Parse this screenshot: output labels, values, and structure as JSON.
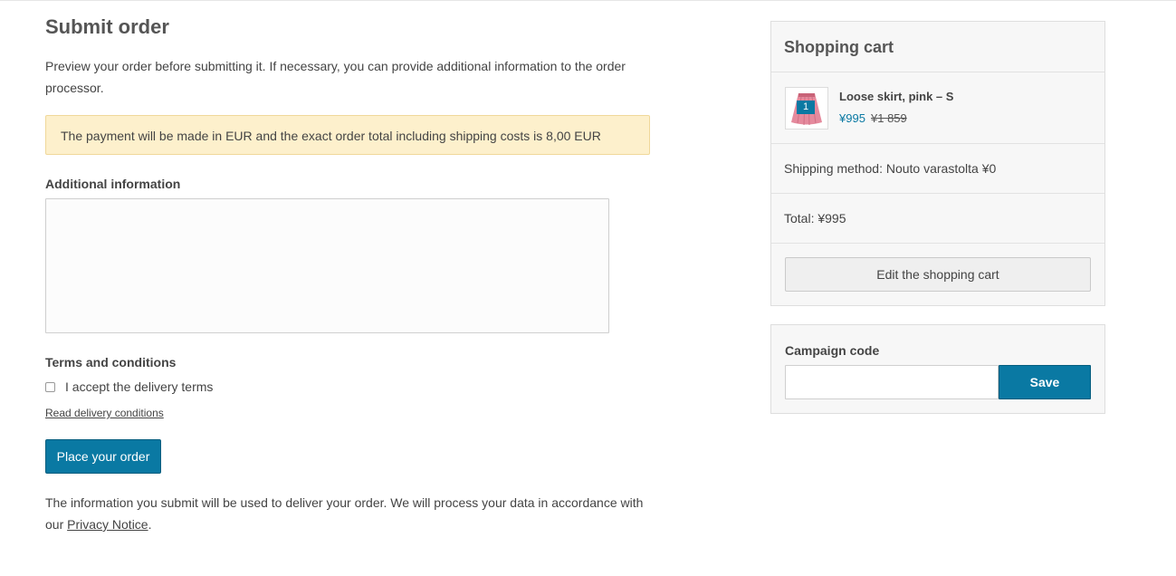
{
  "page": {
    "title": "Submit order",
    "intro": "Preview your order before submitting it. If necessary, you can provide additional information to the order processor.",
    "notice": "The payment will be made in EUR and the exact order total including shipping costs is 8,00 EUR"
  },
  "additional_info": {
    "label": "Additional information",
    "value": ""
  },
  "terms": {
    "heading": "Terms and conditions",
    "checkbox_label": "I accept the delivery terms",
    "checked": false,
    "read_link": "Read delivery conditions"
  },
  "actions": {
    "place_order_label": "Place your order"
  },
  "footnote": {
    "text_before": "The information you submit will be used to deliver your order. We will process your data in accordance with our ",
    "link": "Privacy Notice",
    "text_after": "."
  },
  "cart": {
    "title": "Shopping cart",
    "item": {
      "name": "Loose skirt, pink – S",
      "quantity": "1",
      "price": "¥995",
      "original_price": "¥1 859",
      "thumbnail_icon": "pink-skirt-image"
    },
    "shipping": "Shipping method: Nouto varastolta ¥0",
    "total": "Total: ¥995",
    "edit_label": "Edit the shopping cart"
  },
  "campaign": {
    "label": "Campaign code",
    "value": "",
    "save_label": "Save"
  },
  "colors": {
    "accent": "#0a79a3",
    "notice_bg": "#fdf0cc",
    "panel_bg": "#f7f7f7"
  }
}
